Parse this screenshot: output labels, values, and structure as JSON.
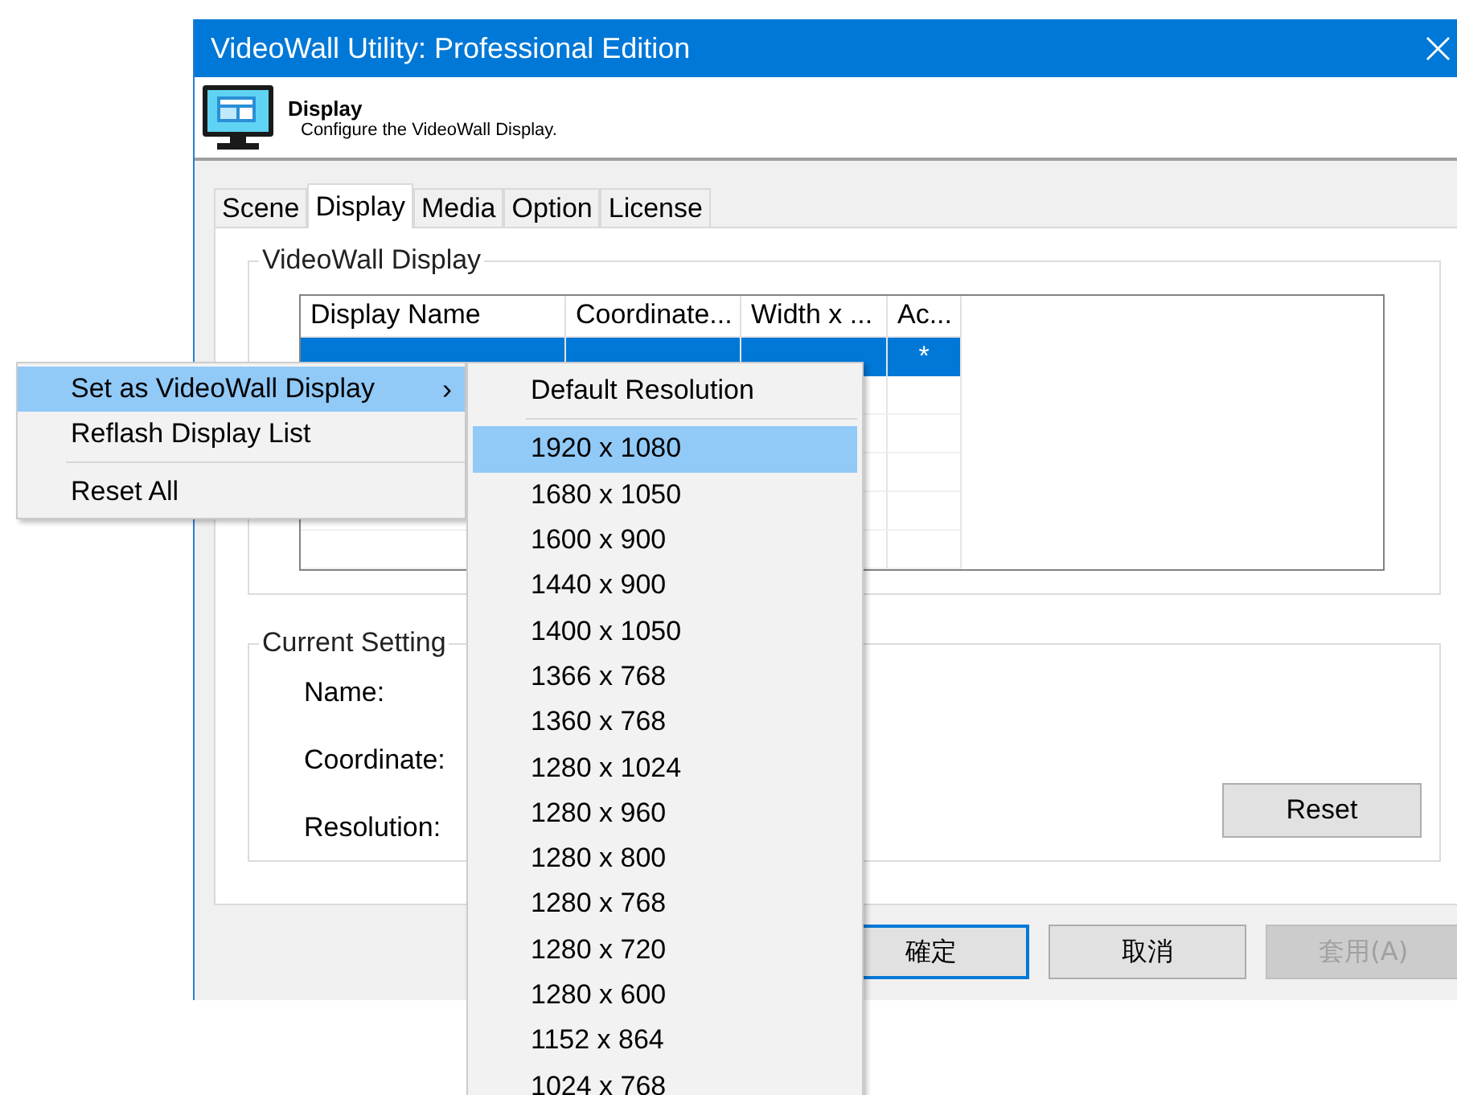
{
  "window": {
    "title": "VideoWall Utility: Professional Edition",
    "close": "×"
  },
  "header": {
    "title": "Display",
    "subtitle": "Configure the VideoWall Display."
  },
  "tabs": [
    {
      "label": "Scene",
      "selected": false
    },
    {
      "label": "Display",
      "selected": true
    },
    {
      "label": "Media",
      "selected": false
    },
    {
      "label": "Option",
      "selected": false
    },
    {
      "label": "License",
      "selected": false
    }
  ],
  "videowall_display": {
    "title": "VideoWall Display",
    "columns": [
      "Display Name",
      "Coordinate...",
      "Width x ...",
      "Ac..."
    ],
    "rows": [
      {
        "selected": true,
        "active": "*"
      }
    ]
  },
  "current_setting": {
    "title": "Current Setting",
    "labels": [
      "Name:",
      "Coordinate:",
      "Resolution:"
    ],
    "reset_button": "Reset"
  },
  "buttons": [
    {
      "label": "確定",
      "default": true,
      "disabled": false
    },
    {
      "label": "取消",
      "default": false,
      "disabled": false
    },
    {
      "label": "套用(A)",
      "default": false,
      "disabled": true
    }
  ],
  "context_menu": {
    "items": [
      {
        "kind": "item",
        "label": "Set as VideoWall Display",
        "selected": true,
        "submenu": true
      },
      {
        "kind": "item",
        "label": "Reflash Display List",
        "selected": false,
        "submenu": false
      },
      {
        "kind": "separator"
      },
      {
        "kind": "item",
        "label": "Reset All",
        "selected": false,
        "submenu": false
      }
    ],
    "arrow": "›"
  },
  "submenu": {
    "items": [
      {
        "kind": "item",
        "label": "Default Resolution",
        "selected": false
      },
      {
        "kind": "separator"
      },
      {
        "kind": "item",
        "label": "1920 x 1080",
        "selected": true
      },
      {
        "kind": "item",
        "label": "1680 x 1050",
        "selected": false
      },
      {
        "kind": "item",
        "label": "1600 x 900",
        "selected": false
      },
      {
        "kind": "item",
        "label": "1440 x 900",
        "selected": false
      },
      {
        "kind": "item",
        "label": "1400 x 1050",
        "selected": false
      },
      {
        "kind": "item",
        "label": "1366 x 768",
        "selected": false
      },
      {
        "kind": "item",
        "label": "1360 x 768",
        "selected": false
      },
      {
        "kind": "item",
        "label": "1280 x 1024",
        "selected": false
      },
      {
        "kind": "item",
        "label": "1280 x 960",
        "selected": false
      },
      {
        "kind": "item",
        "label": "1280 x 800",
        "selected": false
      },
      {
        "kind": "item",
        "label": "1280 x 768",
        "selected": false
      },
      {
        "kind": "item",
        "label": "1280 x 720",
        "selected": false
      },
      {
        "kind": "item",
        "label": "1280 x 600",
        "selected": false
      },
      {
        "kind": "item",
        "label": "1152 x 864",
        "selected": false
      },
      {
        "kind": "item",
        "label": "1024 x 768",
        "selected": false
      }
    ]
  }
}
